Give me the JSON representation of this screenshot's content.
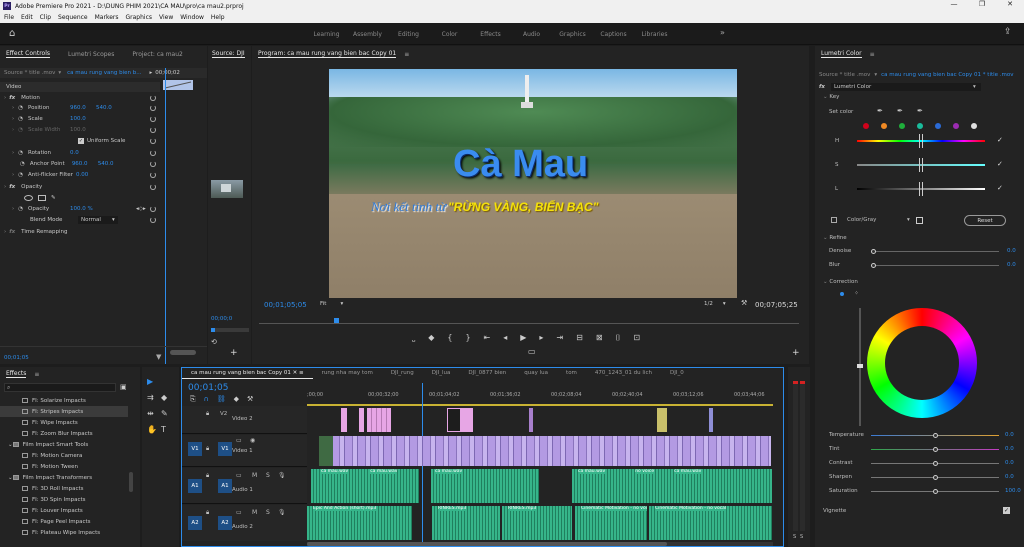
{
  "window": {
    "title": "Adobe Premiere Pro 2021 - D:\\DUNG PHIM 2021\\CA MAU\\pro\\ca mau2.prproj"
  },
  "menu": [
    "File",
    "Edit",
    "Clip",
    "Sequence",
    "Markers",
    "Graphics",
    "View",
    "Window",
    "Help"
  ],
  "workspaces": [
    "Learning",
    "Assembly",
    "Editing",
    "Color",
    "Effects",
    "Audio",
    "Graphics",
    "Captions",
    "Libraries"
  ],
  "effect_controls": {
    "tabs": [
      "Effect Controls",
      "Lumetri Scopes",
      "Project: ca mau2"
    ],
    "source_label": "Source * title .mov",
    "clip_label": "ca mau rung vang bien b...",
    "timecode_top": "00;00;02",
    "video_label": "Video",
    "motion": "Motion",
    "position": {
      "label": "Position",
      "x": "960.0",
      "y": "540.0"
    },
    "scale": {
      "label": "Scale",
      "value": "100.0"
    },
    "scale_width": {
      "label": "Scale Width",
      "value": "100.0"
    },
    "uniform_scale": "Uniform Scale",
    "rotation": {
      "label": "Rotation",
      "value": "0.0"
    },
    "anchor": {
      "label": "Anchor Point",
      "x": "960.0",
      "y": "540.0"
    },
    "antiflicker": {
      "label": "Anti-flicker Filter",
      "value": "0.00"
    },
    "opacity_group": "Opacity",
    "opacity": {
      "label": "Opacity",
      "value": "100.0 %"
    },
    "blend": {
      "label": "Blend Mode",
      "value": "Normal"
    },
    "time_remap": "Time Remapping",
    "bottom_time": "00;01;05"
  },
  "source": {
    "tab": "Source: DJI",
    "timecode": "00;00;0"
  },
  "program": {
    "tab": "Program: ca mau rung vang bien bac Copy 01",
    "title_text": "Cà Mau",
    "subtitle_script": "Nơi kết tinh từ",
    "subtitle_bold": "\"RỪNG VÀNG, BIỂN BẠC\"",
    "timecode": "00;01;05;05",
    "fit": "Fit",
    "resolution": "1/2",
    "duration": "00;07;05;25"
  },
  "effects": {
    "tab": "Effects",
    "items": [
      {
        "label": "FI: Solarize Impacts",
        "indent": 2,
        "sel": false
      },
      {
        "label": "FI: Stripes Impacts",
        "indent": 2,
        "sel": true
      },
      {
        "label": "FI: Wipe Impacts",
        "indent": 2,
        "sel": false
      },
      {
        "label": "FI: Zoom Blur Impacts",
        "indent": 2,
        "sel": false
      },
      {
        "label": "Film Impact Smart Tools",
        "indent": 1,
        "sel": false
      },
      {
        "label": "FI: Motion Camera",
        "indent": 2,
        "sel": false
      },
      {
        "label": "FI: Motion Tween",
        "indent": 2,
        "sel": false
      },
      {
        "label": "Film Impact Transformers",
        "indent": 1,
        "sel": false
      },
      {
        "label": "FI: 3D Roll Impacts",
        "indent": 2,
        "sel": false
      },
      {
        "label": "FI: 3D Spin Impacts",
        "indent": 2,
        "sel": false
      },
      {
        "label": "FI: Louver Impacts",
        "indent": 2,
        "sel": false
      },
      {
        "label": "FI: Page Peel Impacts",
        "indent": 2,
        "sel": false
      },
      {
        "label": "FI: Plateau Wipe Impacts",
        "indent": 2,
        "sel": false
      }
    ]
  },
  "timeline": {
    "tabs": [
      "ca mau rung vang bien bac Copy 01",
      "rung nha may tom",
      "DJI_rung",
      "DJI_lua",
      "DJI_0877 bien",
      "quay lua",
      "tom",
      "470_1243_01 du lich",
      "DJI_0"
    ],
    "timecode": "00;01;05",
    "ruler": [
      ";00;00",
      "00;00;32;00",
      "00;01;04;02",
      "00;01;36;02",
      "00;02;08;04",
      "00;02;40;04",
      "00;03;12;06",
      "00;03;44;06"
    ],
    "tracks": [
      {
        "id": "V2",
        "name": "Video 2"
      },
      {
        "id": "V1",
        "src": "V1",
        "name": "Video 1"
      },
      {
        "id": "A1",
        "src": "A1",
        "name": "Audio 1"
      },
      {
        "id": "A2",
        "src": "A2",
        "name": "Audio 2"
      }
    ],
    "audio_clip_labels": [
      "ca mau.wav",
      "ca mau.wav",
      "ca mau.wav",
      "no voice",
      "ca mau.wav",
      "ca mau.wav"
    ],
    "audio2_clip_labels": [
      "Epic And Action (short).mp3",
      "RINRES.mp3",
      "RINRES.mp3",
      "Cinematic Motivation - no voi",
      "Cinematic Motivation - no vocal"
    ],
    "meter_labels": [
      "S",
      "S"
    ]
  },
  "lumetri": {
    "tab": "Lumetri Color",
    "source_label": "Source * title .mov",
    "clip_label": "ca mau rung vang bien bac Copy 01 * title .mov",
    "fx": "fx",
    "fx_name": "Lumetri Color",
    "key": "Key",
    "set_color": "Set color",
    "hsl": [
      "H",
      "S",
      "L"
    ],
    "color_gray": "Color/Gray",
    "reset": "Reset",
    "refine": "Refine",
    "denoise": {
      "label": "Denoise",
      "value": "0.0"
    },
    "blur": {
      "label": "Blur",
      "value": "0.0"
    },
    "correction": "Correction",
    "sliders": [
      {
        "label": "Temperature",
        "value": "0.0",
        "pos": 0.5
      },
      {
        "label": "Tint",
        "value": "0.0",
        "pos": 0.5
      },
      {
        "label": "Contrast",
        "value": "0.0",
        "pos": 0.5
      },
      {
        "label": "Sharpen",
        "value": "0.0",
        "pos": 0.5
      },
      {
        "label": "Saturation",
        "value": "100.0",
        "pos": 0.5
      }
    ],
    "vignette": "Vignette",
    "swatch_colors": [
      "#d0021b",
      "#f08a24",
      "#1fae3b",
      "#1abc9c",
      "#2b6bd6",
      "#9b2bb2",
      "#e0e0e0"
    ]
  }
}
